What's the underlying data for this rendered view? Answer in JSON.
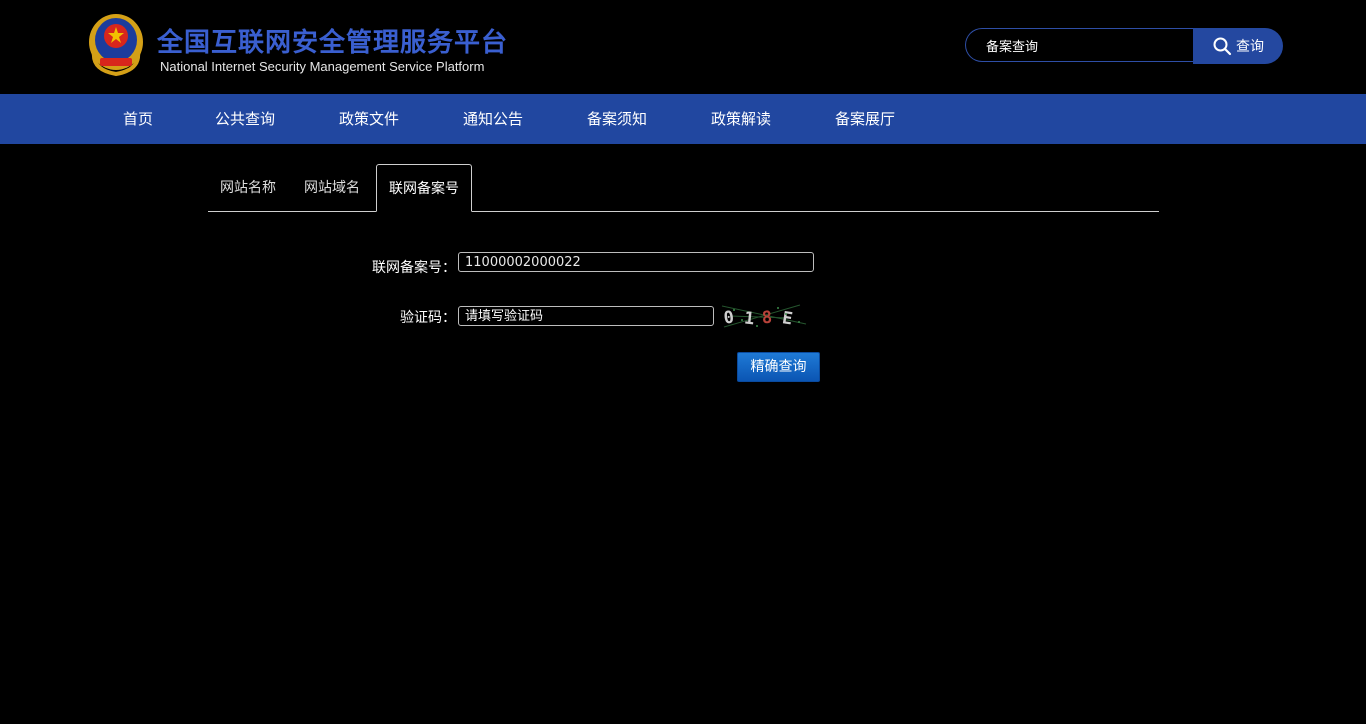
{
  "header": {
    "title_cn": "全国互联网安全管理服务平台",
    "title_en": "National Internet Security Management Service Platform",
    "search": {
      "value": "备案查询",
      "button_label": "查询"
    }
  },
  "nav": {
    "items": [
      {
        "label": "首页"
      },
      {
        "label": "公共查询"
      },
      {
        "label": "政策文件"
      },
      {
        "label": "通知公告"
      },
      {
        "label": "备案须知"
      },
      {
        "label": "政策解读"
      },
      {
        "label": "备案展厅"
      }
    ]
  },
  "tabs": [
    {
      "label": "网站名称",
      "active": false
    },
    {
      "label": "网站域名",
      "active": false
    },
    {
      "label": "联网备案号",
      "active": true
    }
  ],
  "form": {
    "record_label": "联网备案号：",
    "record_value": "11000002000022",
    "captcha_label": "验证码：",
    "captcha_placeholder": "请填写验证码",
    "submit_label": "精确查询"
  },
  "colors": {
    "brand_blue": "#2147a0",
    "title_blue": "#3a5fd0",
    "button_blue": "#1f7ad6"
  },
  "icons": {
    "emblem": "police-emblem-icon",
    "search": "search-icon",
    "captcha": "captcha-image"
  }
}
